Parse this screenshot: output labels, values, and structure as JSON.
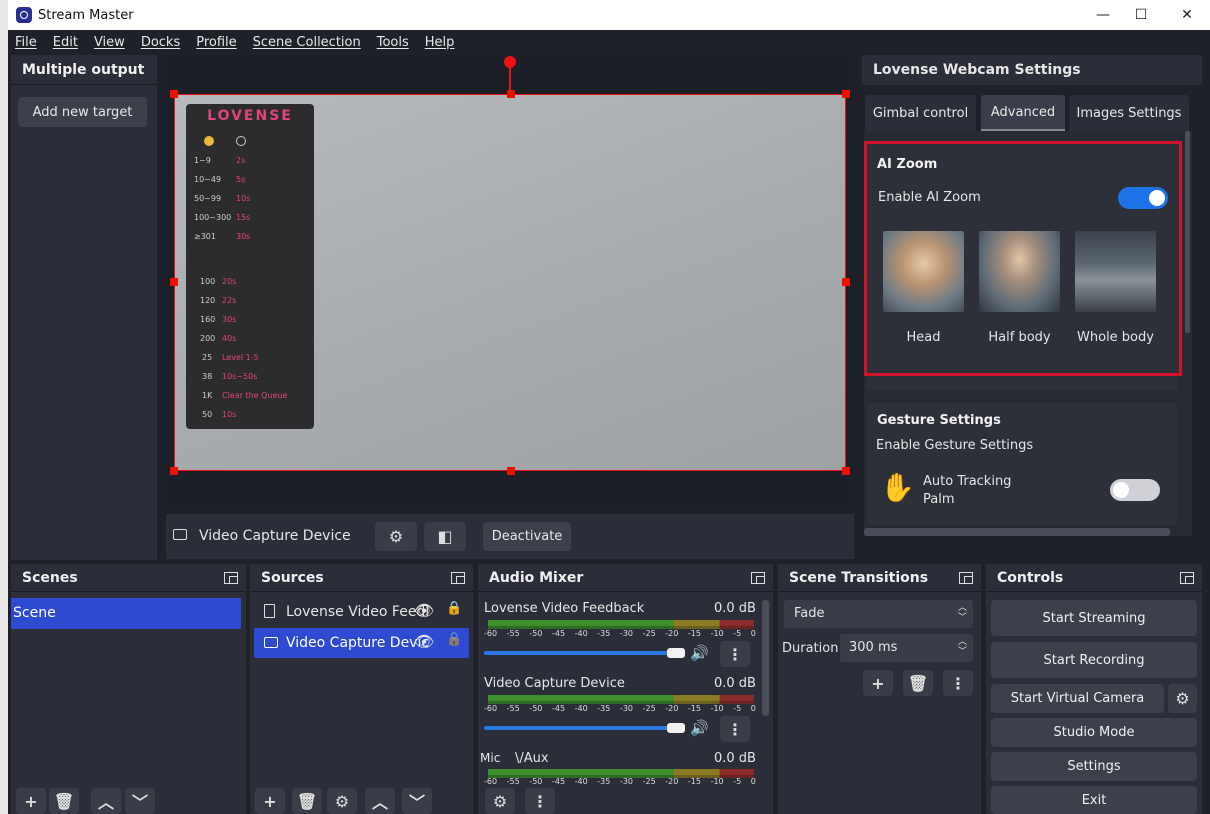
{
  "window": {
    "title": "Stream Master",
    "min": "—",
    "max": "☐",
    "close": "✕"
  },
  "menu": [
    "File",
    "Edit",
    "View",
    "Docks",
    "Profile",
    "Scene Collection",
    "Tools",
    "Help"
  ],
  "multiple_output": {
    "title": "Multiple output",
    "add_button": "Add new target"
  },
  "lovense_overlay": {
    "logo": "LOVENSE",
    "tiers": [
      {
        "range": "1~9",
        "time": "2s"
      },
      {
        "range": "10~49",
        "time": "5s"
      },
      {
        "range": "50~99",
        "time": "10s"
      },
      {
        "range": "100~300",
        "time": "15s"
      },
      {
        "range": "≥301",
        "time": "30s"
      }
    ],
    "specials": [
      {
        "amount": "100",
        "label": "20s"
      },
      {
        "amount": "120",
        "label": "22s"
      },
      {
        "amount": "160",
        "label": "30s"
      },
      {
        "amount": "200",
        "label": "40s"
      },
      {
        "amount": "25",
        "label": "Level 1-5"
      },
      {
        "amount": "38",
        "label": "10s~50s"
      },
      {
        "amount": "1K",
        "label": "Clear the Queue"
      },
      {
        "amount": "50",
        "label": "10s"
      }
    ]
  },
  "source_toolbar": {
    "source_name": "Video Capture Device",
    "deactivate": "Deactivate"
  },
  "settings_panel": {
    "title": "Lovense Webcam Settings",
    "tabs": [
      "Gimbal control",
      "Advanced",
      "Images Settings"
    ],
    "active_tab": "Advanced",
    "ai_zoom": {
      "heading": "AI Zoom",
      "enable_label": "Enable AI Zoom",
      "enabled": true,
      "options": [
        "Head",
        "Half body",
        "Whole body"
      ]
    },
    "gesture": {
      "heading": "Gesture Settings",
      "enable_label": "Enable Gesture Settings",
      "auto_tracking_line1": "Auto Tracking",
      "auto_tracking_line2": "Palm",
      "auto_tracking_enabled": false
    }
  },
  "scenes": {
    "title": "Scenes",
    "items": [
      "Scene"
    ]
  },
  "sources": {
    "title": "Sources",
    "items": [
      "Lovense Video Feedl",
      "Video Capture Devic"
    ]
  },
  "audio_mixer": {
    "title": "Audio Mixer",
    "ticks": [
      "-60",
      "-55",
      "-50",
      "-45",
      "-40",
      "-35",
      "-30",
      "-25",
      "-20",
      "-15",
      "-10",
      "-5",
      "0"
    ],
    "channels": [
      {
        "name": "Lovense Video Feedback",
        "db": "0.0 dB"
      },
      {
        "name": "Video Capture Device",
        "db": "0.0 dB"
      },
      {
        "name": "Mic",
        "name2": "\\/Aux",
        "db": "0.0 dB"
      }
    ]
  },
  "transitions": {
    "title": "Scene Transitions",
    "selected": "Fade",
    "duration_label": "Duration",
    "duration_value": "300 ms"
  },
  "controls": {
    "title": "Controls",
    "start_streaming": "Start Streaming",
    "start_recording": "Start Recording",
    "start_virtual_camera": "Start Virtual Camera",
    "studio_mode": "Studio Mode",
    "settings": "Settings",
    "exit": "Exit"
  }
}
